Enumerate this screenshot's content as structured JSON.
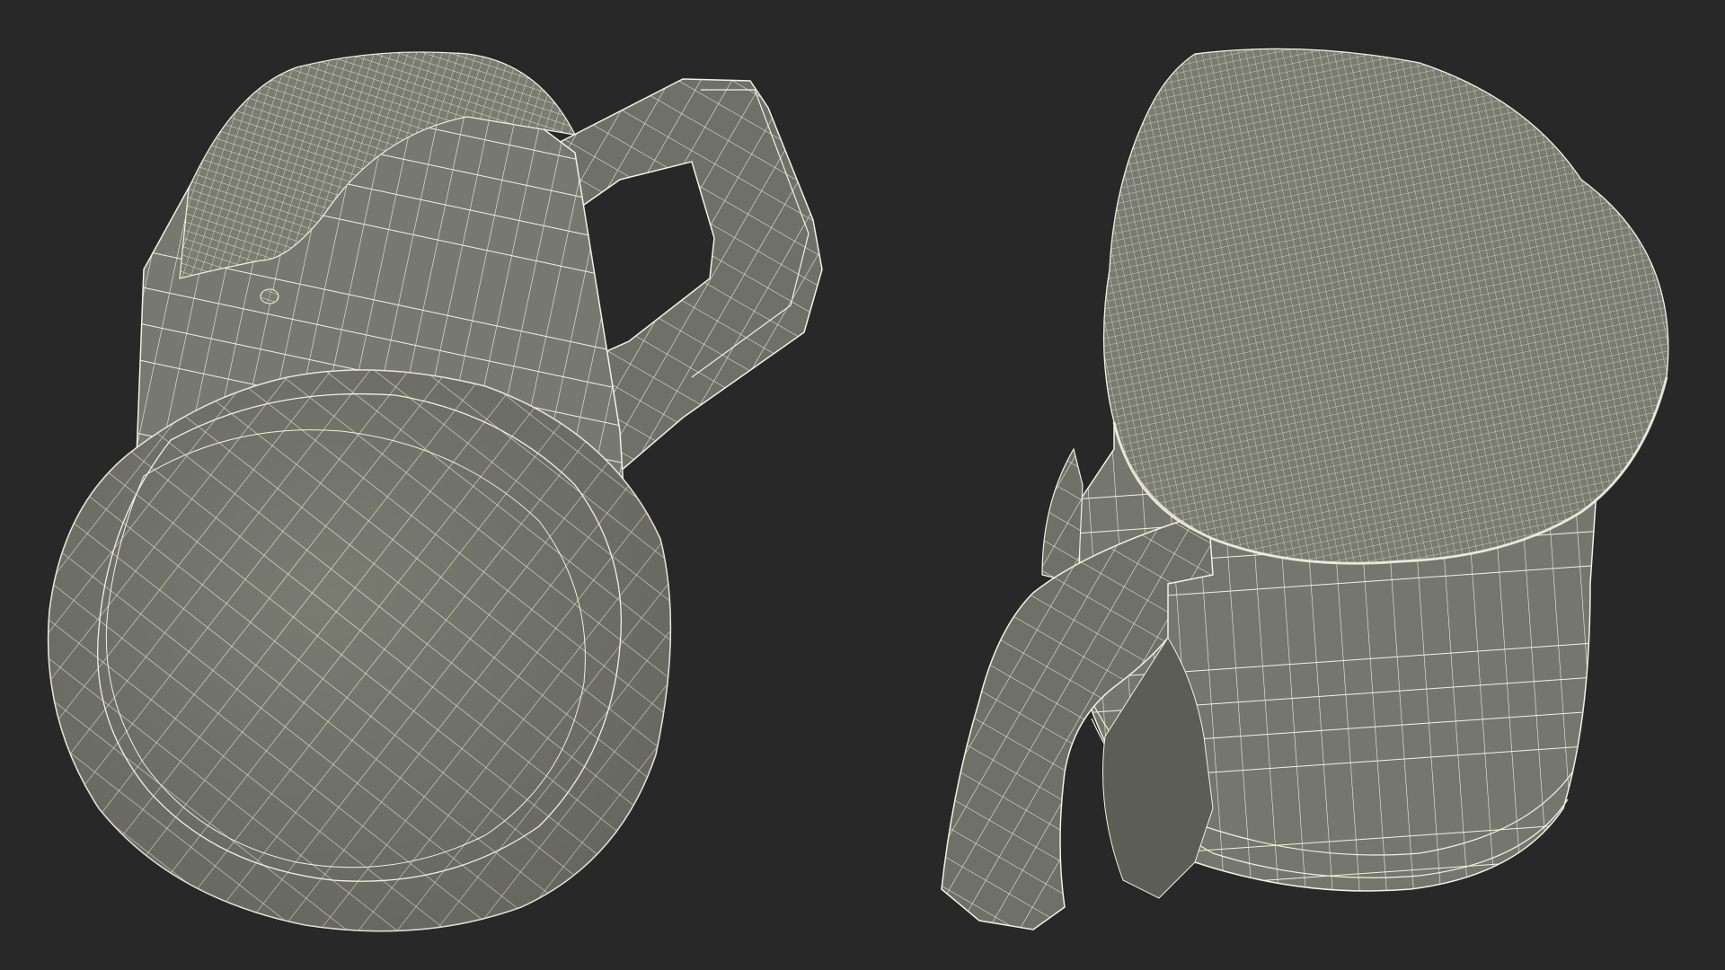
{
  "scene": {
    "background_color": "#282828",
    "mesh_fill_color": "#7a7b71",
    "mesh_shade_color": "#62635a",
    "wire_color": "#f1f1e2"
  },
  "views": [
    {
      "name": "mug-wireframe-bottom-view",
      "description_icon": "wireframe-mug-icon"
    },
    {
      "name": "mug-wireframe-top-view",
      "description_icon": "wireframe-mug-icon"
    }
  ]
}
